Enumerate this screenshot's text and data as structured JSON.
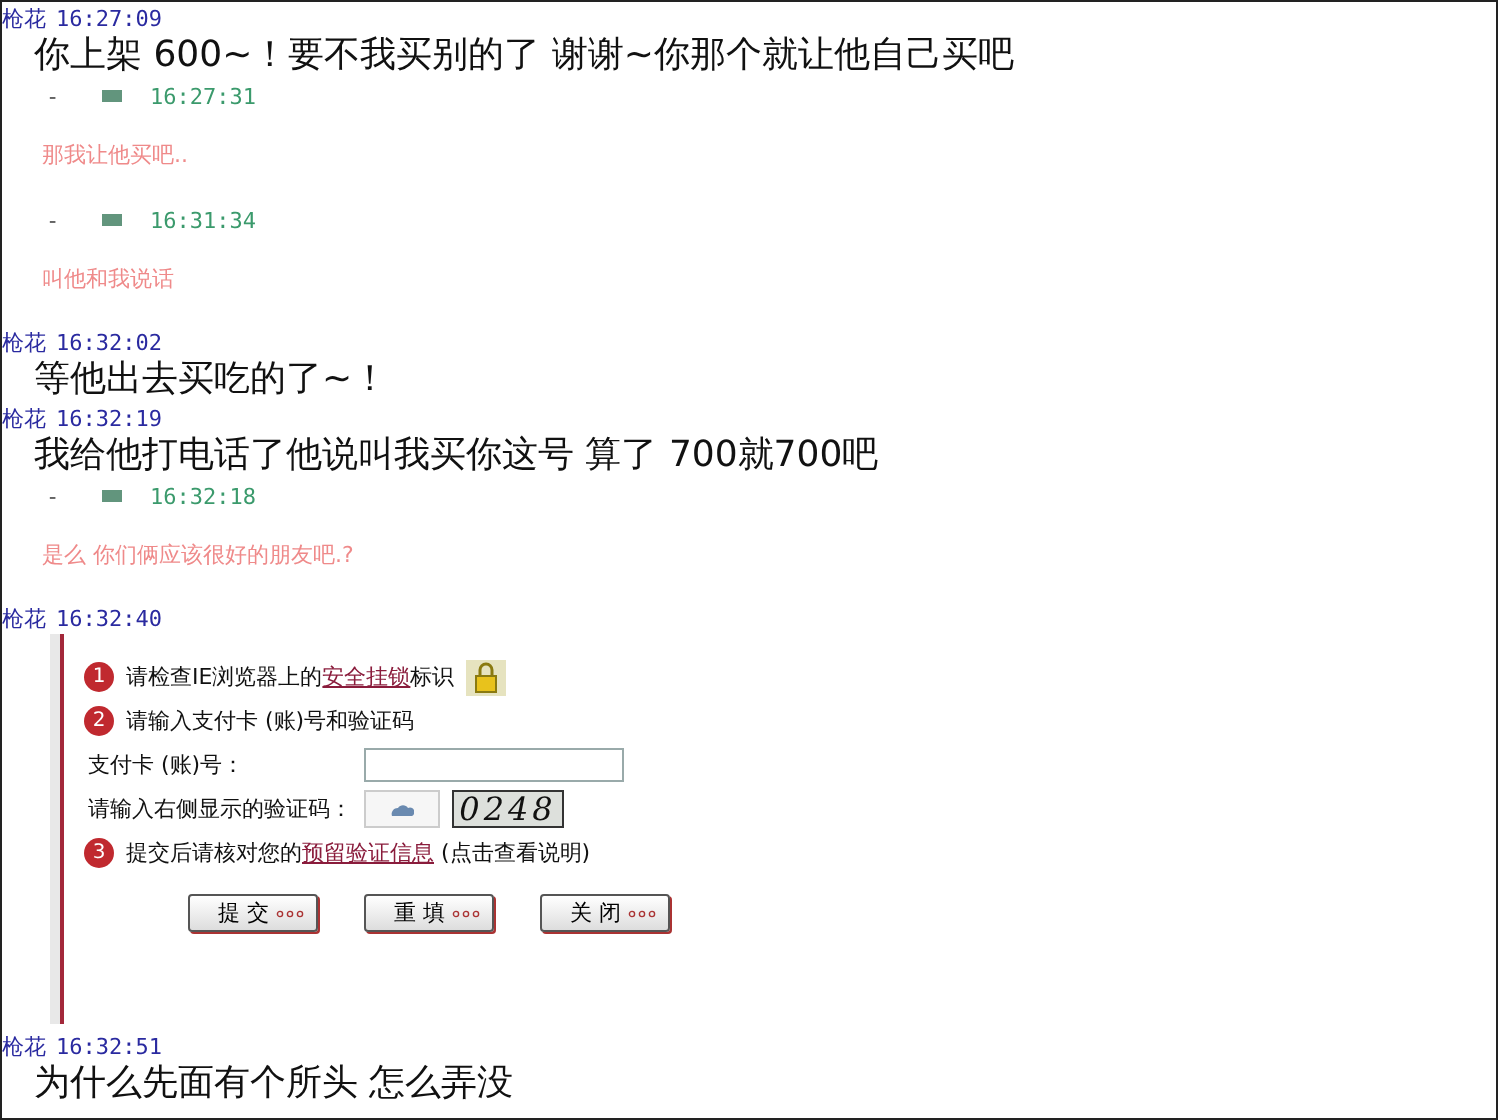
{
  "messages": [
    {
      "kind": "message",
      "sender": "枪花",
      "time": "16:27:09",
      "text": "你上架 600~！要不我买别的了 谢谢~你那个就让他自己买吧"
    },
    {
      "kind": "reply",
      "dash": "-",
      "time": "16:27:31"
    },
    {
      "kind": "note",
      "text": "那我让他买吧.."
    },
    {
      "kind": "reply",
      "dash": "-",
      "time": "16:31:34"
    },
    {
      "kind": "note",
      "text": "叫他和我说话"
    },
    {
      "kind": "message",
      "sender": "枪花",
      "time": "16:32:02",
      "text": "等他出去买吃的了~！"
    },
    {
      "kind": "message",
      "sender": "枪花",
      "time": "16:32:19",
      "text": "我给他打电话了他说叫我买你这号  算了 700就700吧"
    },
    {
      "kind": "reply",
      "dash": "-",
      "time": "16:32:18"
    },
    {
      "kind": "note",
      "text": "是么 你们俩应该很好的朋友吧.?"
    },
    {
      "kind": "screenshot",
      "sender": "枪花",
      "time": "16:32:40",
      "panel": {
        "steps": [
          {
            "number": "1",
            "before": "请检查IE浏览器上的",
            "link": "安全挂锁",
            "after": "标识",
            "lock": true
          },
          {
            "number": "2",
            "before": "请输入支付卡 (账)号和验证码"
          }
        ],
        "card_label": "支付卡 (账)号：",
        "code_label": "请输入右侧显示的验证码：",
        "captcha": "0248",
        "final_step": {
          "number": "3",
          "before": "提交后请核对您的",
          "link": "预留验证信息",
          "after": " (点击查看说明)"
        },
        "buttons": [
          "提 交",
          "重 填",
          "关 闭"
        ]
      }
    },
    {
      "kind": "message",
      "sender": "枪花",
      "time": "16:32:51",
      "text": "为什么先面有个所头 怎么弄没"
    }
  ]
}
